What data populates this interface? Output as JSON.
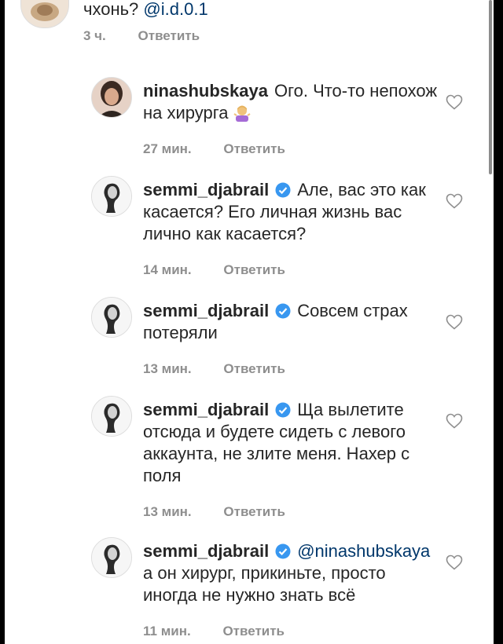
{
  "top_comment": {
    "text": "чхонь?",
    "mention": "@i.d.0.1",
    "time": "3 ч.",
    "reply": "Ответить"
  },
  "replies": [
    {
      "username": "ninashubskaya",
      "verified": false,
      "mention": "",
      "text": "Ого. Что-то непохож на хирурга",
      "emoji": "person-shrugging-emoji",
      "time": "27 мин.",
      "reply": "Ответить"
    },
    {
      "username": "semmi_djabrail",
      "verified": true,
      "mention": "",
      "text": "Але, вас это как касается? Его личная жизнь вас лично как касается?",
      "time": "14 мин.",
      "reply": "Ответить"
    },
    {
      "username": "semmi_djabrail",
      "verified": true,
      "mention": "",
      "text": "Совсем страх потеряли",
      "time": "13 мин.",
      "reply": "Ответить"
    },
    {
      "username": "semmi_djabrail",
      "verified": true,
      "mention": "",
      "text": "Ща вылетите отсюда и будете сидеть с левого аккаунта, не злите меня. Нахер с поля",
      "time": "13 мин.",
      "reply": "Ответить"
    },
    {
      "username": "semmi_djabrail",
      "verified": true,
      "mention": "@ninashubskaya",
      "text": "а он хирург, прикиньте, просто иногда не нужно знать всё",
      "time": "11 мин.",
      "reply": "Ответить"
    }
  ],
  "colors": {
    "text": "#262626",
    "secondary": "#8e8e8e",
    "verified": "#3897f0",
    "mention": "#00376b"
  }
}
